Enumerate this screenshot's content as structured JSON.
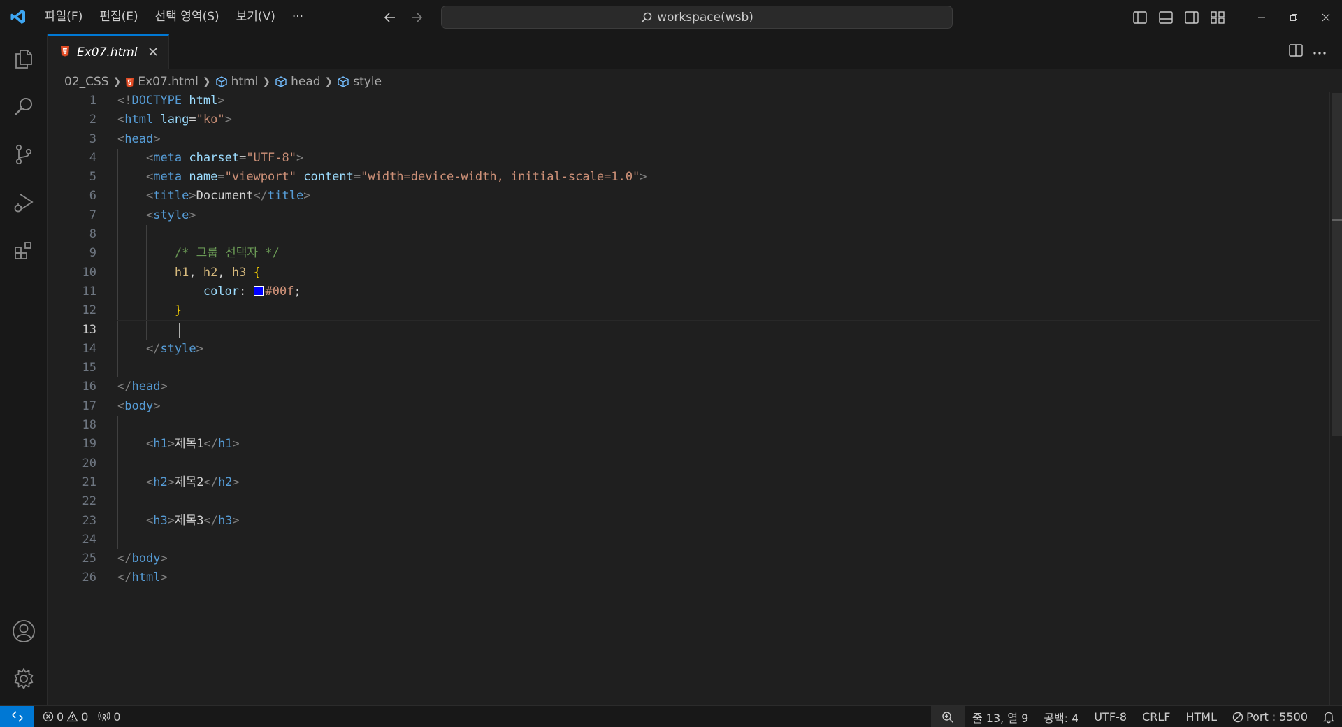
{
  "titlebar": {
    "menu": [
      "파일(F)",
      "편집(E)",
      "선택 영역(S)",
      "보기(V)",
      "···"
    ],
    "search_text": "workspace(wsb)"
  },
  "tab": {
    "label": "Ex07.html"
  },
  "breadcrumb": [
    "02_CSS",
    "Ex07.html",
    "html",
    "head",
    "style"
  ],
  "editor": {
    "current_line": 13,
    "line_numbers": [
      "1",
      "2",
      "3",
      "4",
      "5",
      "6",
      "7",
      "8",
      "9",
      "10",
      "11",
      "12",
      "13",
      "14",
      "15",
      "16",
      "17",
      "18",
      "19",
      "20",
      "21",
      "22",
      "23",
      "24",
      "25",
      "26"
    ],
    "lines": [
      [
        [
          "t-punc",
          "<!"
        ],
        [
          "t-tag",
          "DOCTYPE"
        ],
        [
          "t-text",
          " "
        ],
        [
          "t-attr",
          "html"
        ],
        [
          "t-punc",
          ">"
        ]
      ],
      [
        [
          "t-punc",
          "<"
        ],
        [
          "t-tag",
          "html"
        ],
        [
          "t-text",
          " "
        ],
        [
          "t-attr",
          "lang"
        ],
        [
          "t-text",
          "="
        ],
        [
          "t-str",
          "\"ko\""
        ],
        [
          "t-punc",
          ">"
        ]
      ],
      [
        [
          "t-punc",
          "<"
        ],
        [
          "t-tag",
          "head"
        ],
        [
          "t-punc",
          ">"
        ]
      ],
      [
        [
          "t-text",
          "    "
        ],
        [
          "t-punc",
          "<"
        ],
        [
          "t-tag",
          "meta"
        ],
        [
          "t-text",
          " "
        ],
        [
          "t-attr",
          "charset"
        ],
        [
          "t-text",
          "="
        ],
        [
          "t-str",
          "\"UTF-8\""
        ],
        [
          "t-punc",
          ">"
        ]
      ],
      [
        [
          "t-text",
          "    "
        ],
        [
          "t-punc",
          "<"
        ],
        [
          "t-tag",
          "meta"
        ],
        [
          "t-text",
          " "
        ],
        [
          "t-attr",
          "name"
        ],
        [
          "t-text",
          "="
        ],
        [
          "t-str",
          "\"viewport\""
        ],
        [
          "t-text",
          " "
        ],
        [
          "t-attr",
          "content"
        ],
        [
          "t-text",
          "="
        ],
        [
          "t-str",
          "\"width=device-width, initial-scale=1.0\""
        ],
        [
          "t-punc",
          ">"
        ]
      ],
      [
        [
          "t-text",
          "    "
        ],
        [
          "t-punc",
          "<"
        ],
        [
          "t-tag",
          "title"
        ],
        [
          "t-punc",
          ">"
        ],
        [
          "t-text",
          "Document"
        ],
        [
          "t-punc",
          "</"
        ],
        [
          "t-tag",
          "title"
        ],
        [
          "t-punc",
          ">"
        ]
      ],
      [
        [
          "t-text",
          "    "
        ],
        [
          "t-punc",
          "<"
        ],
        [
          "t-tag",
          "style"
        ],
        [
          "t-punc",
          ">"
        ]
      ],
      [],
      [
        [
          "t-text",
          "        "
        ],
        [
          "t-comment",
          "/* 그룹 선택자 */"
        ]
      ],
      [
        [
          "t-text",
          "        "
        ],
        [
          "t-sel",
          "h1"
        ],
        [
          "t-text",
          ", "
        ],
        [
          "t-sel",
          "h2"
        ],
        [
          "t-text",
          ", "
        ],
        [
          "t-sel",
          "h3"
        ],
        [
          "t-text",
          " "
        ],
        [
          "t-brace",
          "{"
        ]
      ],
      [
        [
          "t-text",
          "            "
        ],
        [
          "t-prop",
          "color"
        ],
        [
          "t-text",
          ": "
        ],
        [
          "swatch",
          ""
        ],
        [
          "t-str",
          "#00f"
        ],
        [
          "t-text",
          ";"
        ]
      ],
      [
        [
          "t-text",
          "        "
        ],
        [
          "t-brace",
          "}"
        ]
      ],
      [],
      [
        [
          "t-text",
          "    "
        ],
        [
          "t-punc",
          "</"
        ],
        [
          "t-tag",
          "style"
        ],
        [
          "t-punc",
          ">"
        ]
      ],
      [],
      [
        [
          "t-punc",
          "</"
        ],
        [
          "t-tag",
          "head"
        ],
        [
          "t-punc",
          ">"
        ]
      ],
      [
        [
          "t-punc",
          "<"
        ],
        [
          "t-tag",
          "body"
        ],
        [
          "t-punc",
          ">"
        ]
      ],
      [],
      [
        [
          "t-text",
          "    "
        ],
        [
          "t-punc",
          "<"
        ],
        [
          "t-tag",
          "h1"
        ],
        [
          "t-punc",
          ">"
        ],
        [
          "t-text",
          "제목1"
        ],
        [
          "t-punc",
          "</"
        ],
        [
          "t-tag",
          "h1"
        ],
        [
          "t-punc",
          ">"
        ]
      ],
      [],
      [
        [
          "t-text",
          "    "
        ],
        [
          "t-punc",
          "<"
        ],
        [
          "t-tag",
          "h2"
        ],
        [
          "t-punc",
          ">"
        ],
        [
          "t-text",
          "제목2"
        ],
        [
          "t-punc",
          "</"
        ],
        [
          "t-tag",
          "h2"
        ],
        [
          "t-punc",
          ">"
        ]
      ],
      [],
      [
        [
          "t-text",
          "    "
        ],
        [
          "t-punc",
          "<"
        ],
        [
          "t-tag",
          "h3"
        ],
        [
          "t-punc",
          ">"
        ],
        [
          "t-text",
          "제목3"
        ],
        [
          "t-punc",
          "</"
        ],
        [
          "t-tag",
          "h3"
        ],
        [
          "t-punc",
          ">"
        ]
      ],
      [],
      [
        [
          "t-punc",
          "</"
        ],
        [
          "t-tag",
          "body"
        ],
        [
          "t-punc",
          ">"
        ]
      ],
      [
        [
          "t-punc",
          "</"
        ],
        [
          "t-tag",
          "html"
        ],
        [
          "t-punc",
          ">"
        ]
      ]
    ]
  },
  "statusbar": {
    "errors": "0",
    "warnings": "0",
    "ports": "0",
    "position": "줄 13, 열 9",
    "indent": "공백: 4",
    "encoding": "UTF-8",
    "eol": "CRLF",
    "language": "HTML",
    "live_server": "Port : 5500"
  },
  "colors": {
    "accent": "#0078d4",
    "html_icon": "#e44d26",
    "swatch": "#0000ff"
  }
}
